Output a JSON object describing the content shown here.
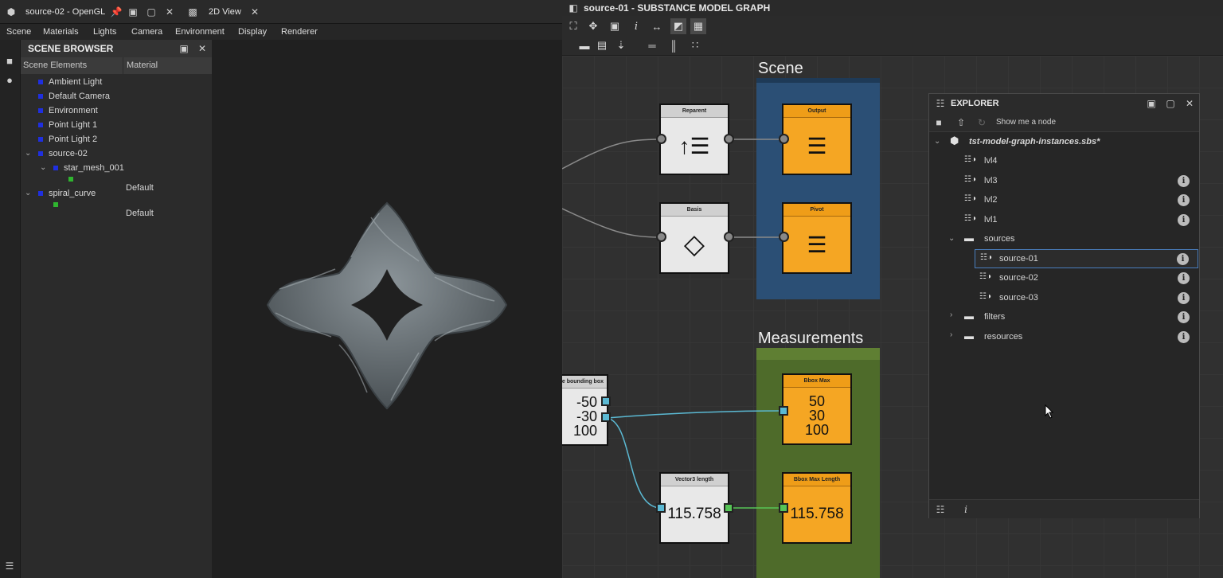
{
  "left_window": {
    "tab1_title": "source-02 - OpenGL",
    "tab2_title": "2D View",
    "menu": [
      "Scene",
      "Materials",
      "Lights",
      "Camera",
      "Environment",
      "Display",
      "Renderer"
    ],
    "scene_browser": {
      "title": "SCENE BROWSER",
      "col_elements": "Scene Elements",
      "col_material": "Material",
      "items": [
        {
          "label": "Ambient Light"
        },
        {
          "label": "Default Camera"
        },
        {
          "label": "Environment"
        },
        {
          "label": "Point Light 1"
        },
        {
          "label": "Point Light 2"
        },
        {
          "label": "source-02"
        },
        {
          "label": "star_mesh_001"
        },
        {
          "label": "Default"
        },
        {
          "label": "spiral_curve"
        },
        {
          "label": "Default"
        }
      ]
    }
  },
  "right_window": {
    "title": "source-01 - SUBSTANCE MODEL GRAPH",
    "groups": {
      "scene": "Scene",
      "measurements": "Measurements"
    },
    "nodes": {
      "reparent": "Reparent",
      "basis": "Basis",
      "output": "Output",
      "pivot": "Pivot",
      "bbox_src": "e bounding box",
      "bbox_src_values": [
        "-50",
        "-30",
        "100"
      ],
      "bbox_max": "Bbox Max",
      "bbox_max_values": [
        "50",
        "30",
        "100"
      ],
      "vec3_len": "Vector3 length",
      "vec3_len_value": "115.758",
      "bbox_max_len": "Bbox Max Length",
      "bbox_max_len_value": "115.758"
    },
    "explorer": {
      "title": "EXPLORER",
      "show_node": "Show me a node",
      "file": "tst-model-graph-instances.sbs*",
      "rows": [
        {
          "label": "lvl4"
        },
        {
          "label": "lvl3"
        },
        {
          "label": "lvl2"
        },
        {
          "label": "lvl1"
        },
        {
          "label": "sources"
        },
        {
          "label": "source-01"
        },
        {
          "label": "source-02"
        },
        {
          "label": "source-03"
        },
        {
          "label": "filters"
        },
        {
          "label": "resources"
        }
      ]
    }
  },
  "colors": {
    "orange": "#f5a623",
    "scene_group": "#2b4f75",
    "measure_group": "#4e6b2a",
    "port_blue": "#5bb9d3",
    "port_green": "#56c456",
    "selected": "#4a7fbf"
  }
}
